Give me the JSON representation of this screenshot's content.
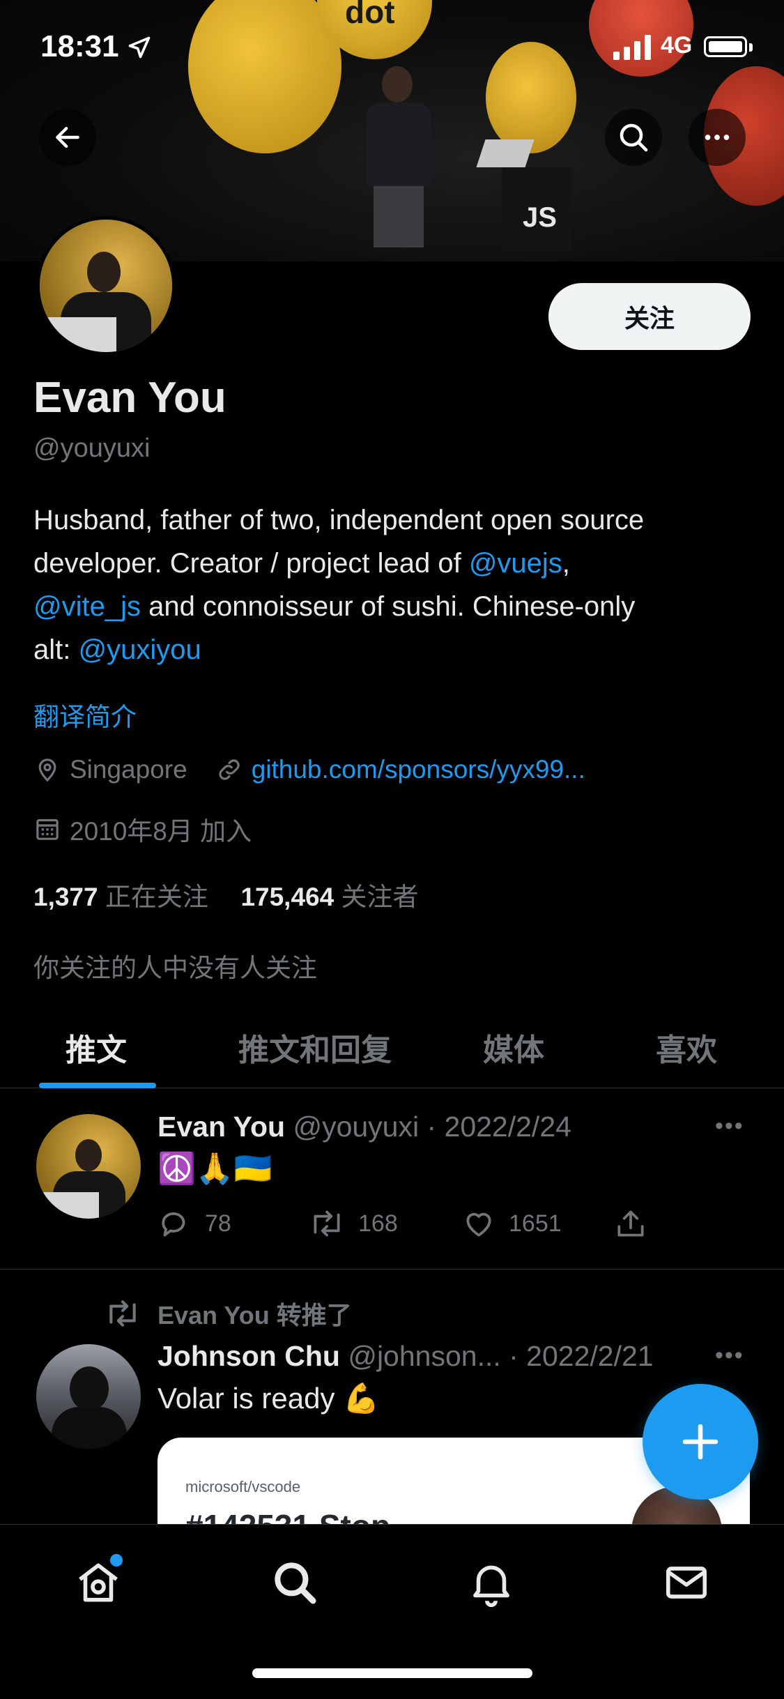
{
  "status_bar": {
    "time": "18:31",
    "network": "4G"
  },
  "banner": {
    "visible_text": "JS",
    "logo_text": "dot"
  },
  "profile": {
    "follow_label": "关注",
    "name": "Evan You",
    "handle": "@youyuxi",
    "bio": {
      "line1": "Husband, father of two, independent open source",
      "line2_a": "developer. Creator / project lead of ",
      "line2_link": "@vuejs",
      "line2_b": ",",
      "line3_link": "@vite_js",
      "line3_b": " and connoisseur of sushi. Chinese-only",
      "line4_a": "alt: ",
      "line4_link": "@yuxiyou"
    },
    "translate_label": "翻译简介",
    "location": "Singapore",
    "website": "github.com/sponsors/yyx99...",
    "joined": "2010年8月 加入",
    "following_count": "1,377",
    "following_label": "正在关注",
    "followers_count": "175,464",
    "followers_label": "关注者",
    "mutuals_note": "你关注的人中没有人关注"
  },
  "tabs": [
    {
      "label": "推文",
      "active": true
    },
    {
      "label": "推文和回复",
      "active": false
    },
    {
      "label": "媒体",
      "active": false
    },
    {
      "label": "喜欢",
      "active": false
    }
  ],
  "tweets": [
    {
      "author": "Evan You",
      "handle_date": "@youyuxi · 2022/2/24",
      "text": "☮️🙏🇺🇦",
      "replies": "78",
      "retweets": "168",
      "likes": "1651"
    },
    {
      "retweeted_by": "Evan You 转推了",
      "author": "Johnson Chu",
      "handle_date": "@johnson... · 2022/2/21",
      "text": "Volar is ready 💪",
      "card_repo": "microsoft/vscode",
      "card_title_partial": "#142531 Stop"
    }
  ],
  "colors": {
    "accent": "#1d9bf0",
    "background": "#000000",
    "secondary_text": "#71767b"
  },
  "icons": [
    "back-arrow-icon",
    "search-icon",
    "more-icon",
    "location-icon",
    "link-icon",
    "calendar-icon",
    "reply-icon",
    "retweet-icon",
    "like-icon",
    "share-icon",
    "compose-plus-icon",
    "home-icon",
    "explore-icon",
    "notifications-icon",
    "messages-icon"
  ]
}
